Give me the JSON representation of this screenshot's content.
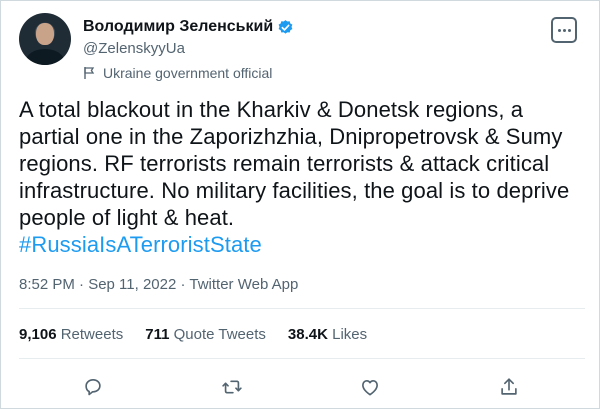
{
  "author": {
    "display_name": "Володимир Зеленський",
    "handle": "@ZelenskyyUa",
    "affiliation": "Ukraine government official"
  },
  "tweet": {
    "text": "A total blackout in the Kharkiv & Donetsk regions, a partial one in the Zaporizhzhia, Dnipropetrovsk & Sumy regions. RF terrorists remain terrorists & attack critical infrastructure. No military facilities, the goal is to deprive people of light & heat.",
    "hashtag": "#RussiaIsATerroristState",
    "timestamp": "8:52 PM · Sep 11, 2022 · Twitter Web App"
  },
  "stats": {
    "retweets_count": "9,106",
    "retweets_label": "Retweets",
    "quotes_count": "711",
    "quotes_label": "Quote Tweets",
    "likes_count": "38.4K",
    "likes_label": "Likes"
  },
  "icons": {
    "verified": "verified-badge-icon",
    "affiliation": "flag-icon",
    "more": "more-options-icon",
    "reply": "reply-icon",
    "retweet": "retweet-icon",
    "like": "like-icon",
    "share": "share-icon"
  },
  "colors": {
    "accent": "#1d9bf0",
    "text": "#0f1419",
    "muted": "#536471"
  }
}
